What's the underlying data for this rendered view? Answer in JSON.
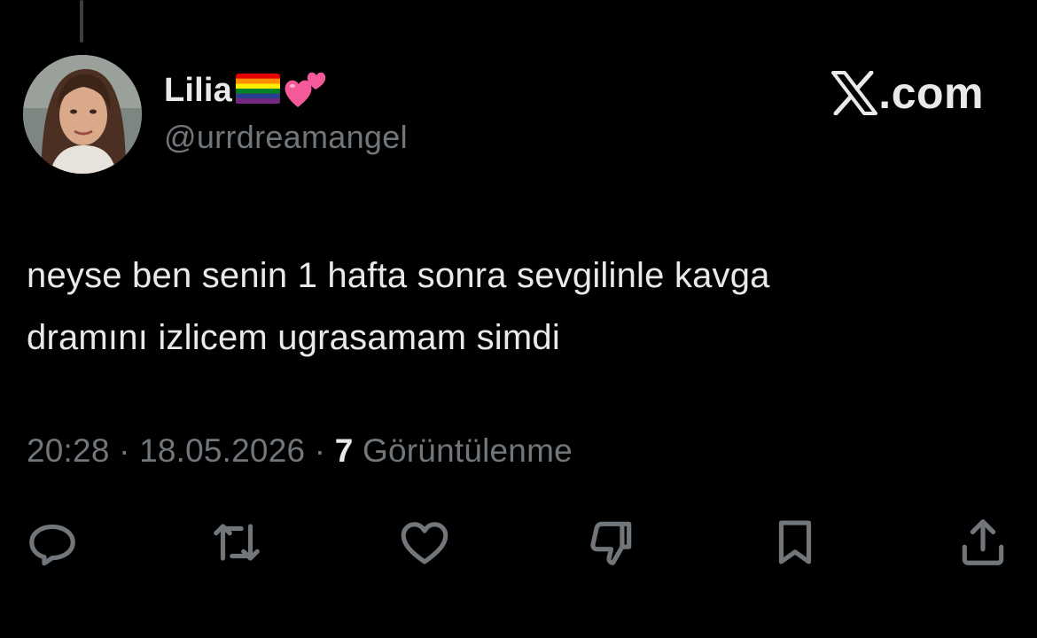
{
  "author": {
    "display_name": "Lilia",
    "name_emojis": [
      "rainbow-flag-emoji",
      "two-hearts-emoji"
    ],
    "handle": "@urrdreamangel"
  },
  "brand": {
    "label": ".com",
    "icon": "x-logo-icon"
  },
  "tweet": {
    "lines": [
      "neyse ben senin 1 hafta sonra sevgilinle kavga",
      "dramını izlicem ugrasamam simdi"
    ]
  },
  "meta": {
    "time": "20:28",
    "separator_1": " · ",
    "date": "18.05.2026",
    "separator_2": " · ",
    "views_count": "7",
    "views_label": " Görüntülenme"
  },
  "actions": [
    {
      "name": "reply",
      "icon": "reply-icon"
    },
    {
      "name": "retweet",
      "icon": "retweet-icon"
    },
    {
      "name": "like",
      "icon": "heart-icon"
    },
    {
      "name": "dislike",
      "icon": "thumbs-down-icon"
    },
    {
      "name": "bookmark",
      "icon": "bookmark-icon"
    },
    {
      "name": "share",
      "icon": "share-icon"
    }
  ],
  "colors": {
    "background": "#000000",
    "primary_text": "#e7e9ea",
    "secondary_text": "#71767b"
  }
}
